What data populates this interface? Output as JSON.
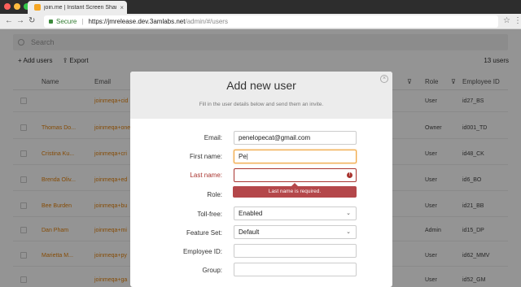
{
  "browser": {
    "tab_title": "join.me | Instant Screen Sharin",
    "tab_close": "×",
    "secure_label": "Secure",
    "url_host": "https://jmrelease.dev.3amlabs.net",
    "url_path": "/admin/#/users"
  },
  "app": {
    "search_placeholder": "Search",
    "add_users_label": "+ Add users",
    "export_label": "Export",
    "user_count": "13 users",
    "columns": {
      "name": "Name",
      "email": "Email",
      "role": "Role",
      "employee_id": "Employee ID"
    },
    "rows": [
      {
        "name": "",
        "email": "joinmeqa+cid",
        "role": "User",
        "employee_id": "id27_BS"
      },
      {
        "name": "Thomas Do...",
        "email": "joinmeqa+one",
        "role": "Owner",
        "employee_id": "id001_TD"
      },
      {
        "name": "Cristina Ku...",
        "email": "joinmeqa+cri",
        "role": "User",
        "employee_id": "id48_CK"
      },
      {
        "name": "Brenda Oliv...",
        "email": "joinmeqa+ed",
        "role": "User",
        "employee_id": "id6_BO"
      },
      {
        "name": "Bee Burden",
        "email": "joinmeqa+bu",
        "role": "User",
        "employee_id": "id21_BB"
      },
      {
        "name": "Dan Pham",
        "email": "joinmeqa+mi",
        "role": "Admin",
        "employee_id": "id15_DP"
      },
      {
        "name": "Marietta M...",
        "email": "joinmeqa+py",
        "role": "User",
        "employee_id": "id62_MMV"
      },
      {
        "name": "",
        "email": "joinmeqa+ga",
        "role": "User",
        "employee_id": "id52_GM"
      }
    ]
  },
  "modal": {
    "title": "Add new user",
    "subtitle": "Fill in the user details below and send them an invite.",
    "fields": {
      "email": {
        "label": "Email:",
        "value": "penelopecat@gmail.com"
      },
      "first_name": {
        "label": "First name:",
        "value": "Pe"
      },
      "last_name": {
        "label": "Last name:",
        "value": "",
        "error": "Last name is required."
      },
      "role": {
        "label": "Role:"
      },
      "toll_free": {
        "label": "Toll-free:",
        "value": "Enabled"
      },
      "feature_set": {
        "label": "Feature Set:",
        "value": "Default"
      },
      "employee_id": {
        "label": "Employee ID:",
        "value": ""
      },
      "group": {
        "label": "Group:",
        "value": ""
      }
    }
  }
}
